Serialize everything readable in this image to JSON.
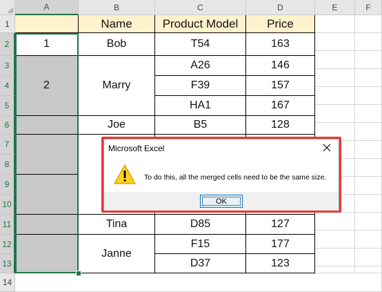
{
  "columns": [
    "A",
    "B",
    "C",
    "D",
    "E",
    "F"
  ],
  "rows": [
    "1",
    "2",
    "3",
    "4",
    "5",
    "6",
    "7",
    "8",
    "9",
    "10",
    "11",
    "12",
    "13",
    "14"
  ],
  "table": {
    "headers": {
      "name": "Name",
      "product_model": "Product Model",
      "price": "Price"
    },
    "col_a": [
      "1",
      "2"
    ],
    "names": [
      "Bob",
      "Marry",
      "Joe",
      "Tina",
      "Janne"
    ],
    "models": [
      "T54",
      "A26",
      "F39",
      "HA1",
      "B5",
      "D85",
      "F15",
      "D37"
    ],
    "prices": [
      "163",
      "146",
      "157",
      "167",
      "128",
      "127",
      "177",
      "123"
    ]
  },
  "dialog": {
    "title": "Microsoft Excel",
    "message": "To do this, all the merged cells need to be the same size.",
    "ok_label": "OK",
    "icon": "warning-icon",
    "close_icon": "close-icon"
  },
  "colors": {
    "header_fill": "#fff2cc",
    "selection": "#217346",
    "merged_grey": "#c8c8c8",
    "highlight_outline": "#e53935"
  }
}
